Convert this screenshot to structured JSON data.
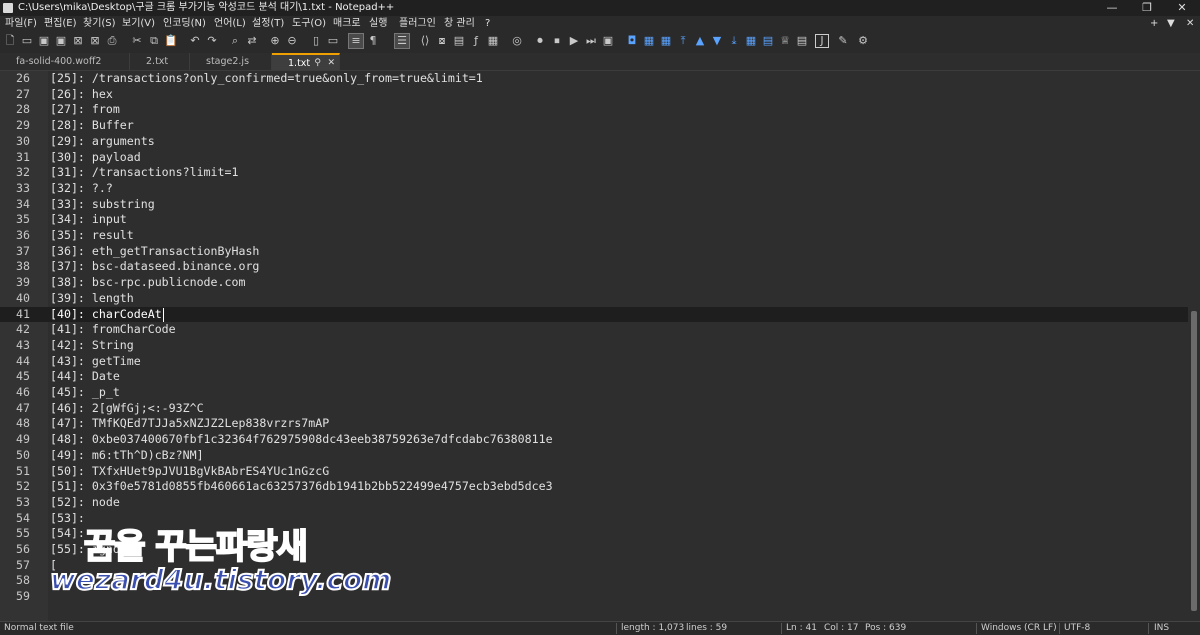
{
  "window": {
    "title": "C:\\Users\\mika\\Desktop\\구글 크롬 부가기능 악성코드 분석 대기\\1.txt - Notepad++",
    "minimize": "—",
    "maximize": "❐",
    "close": "✕"
  },
  "menu": {
    "items": [
      "파일(F)",
      "편집(E)",
      "찾기(S)",
      "보기(V)",
      "인코딩(N)",
      "언어(L)",
      "설정(T)",
      "도구(O)",
      "매크로",
      "실행",
      "플러그인",
      "창 관리",
      "?"
    ],
    "right": [
      "+",
      "▼",
      "✕"
    ]
  },
  "toolbar": {
    "icons": [
      "new-file-icon",
      "open-file-icon",
      "save-icon",
      "save-all-icon",
      "close-icon",
      "close-all-icon",
      "print-icon",
      "cut-icon",
      "copy-icon",
      "paste-icon",
      "undo-icon",
      "redo-icon",
      "find-icon",
      "replace-icon",
      "zoom-in-icon",
      "zoom-out-icon",
      "sync-vertical-icon",
      "sync-horizontal-icon",
      "word-wrap-icon",
      "show-all-chars-icon",
      "indent-guide-icon",
      "udl-icon",
      "xml-icon",
      "doc-map-icon",
      "function-list-icon",
      "folder-workspace-icon",
      "monitor-icon",
      "record-macro-icon",
      "stop-macro-icon",
      "play-macro-icon",
      "run-macro-multiple-icon",
      "save-macro-icon",
      "plugin-1-icon",
      "plugin-2-icon",
      "plugin-3-icon",
      "plugin-4-icon",
      "plugin-5-icon",
      "plugin-6-icon",
      "plugin-7-icon",
      "plugin-8-icon",
      "plugin-9-icon",
      "plugin-10-icon",
      "plugin-11-icon",
      "plugin-12-icon",
      "plugin-13-icon",
      "plugin-14-icon"
    ]
  },
  "tabs": [
    {
      "label": "fa-solid-400.woff2",
      "active": false
    },
    {
      "label": "2.txt",
      "active": false
    },
    {
      "label": "stage2.js",
      "active": false
    },
    {
      "label": "1.txt",
      "active": true
    }
  ],
  "editor": {
    "current_line": 41,
    "lines": [
      {
        "n": "26",
        "text": "[25]: /transactions?only_confirmed=true&only_from=true&limit=1"
      },
      {
        "n": "27",
        "text": "[26]: hex"
      },
      {
        "n": "28",
        "text": "[27]: from"
      },
      {
        "n": "29",
        "text": "[28]: Buffer"
      },
      {
        "n": "30",
        "text": "[29]: arguments"
      },
      {
        "n": "31",
        "text": "[30]: payload"
      },
      {
        "n": "32",
        "text": "[31]: /transactions?limit=1"
      },
      {
        "n": "33",
        "text": "[32]: ?.?"
      },
      {
        "n": "34",
        "text": "[33]: substring"
      },
      {
        "n": "35",
        "text": "[34]: input"
      },
      {
        "n": "36",
        "text": "[35]: result"
      },
      {
        "n": "37",
        "text": "[36]: eth_getTransactionByHash"
      },
      {
        "n": "38",
        "text": "[37]: bsc-dataseed.binance.org"
      },
      {
        "n": "39",
        "text": "[38]: bsc-rpc.publicnode.com"
      },
      {
        "n": "40",
        "text": "[39]: length"
      },
      {
        "n": "41",
        "text": "[40]: charCodeAt"
      },
      {
        "n": "42",
        "text": "[41]: fromCharCode"
      },
      {
        "n": "43",
        "text": "[42]: String"
      },
      {
        "n": "44",
        "text": "[43]: getTime"
      },
      {
        "n": "45",
        "text": "[44]: Date"
      },
      {
        "n": "46",
        "text": "[45]: _p_t"
      },
      {
        "n": "47",
        "text": "[46]: 2[gWfGj;<:-93Z^C"
      },
      {
        "n": "48",
        "text": "[47]: TMfKQEd7TJJa5xNZJZ2Lep838vrzrs7mAP"
      },
      {
        "n": "49",
        "text": "[48]: 0xbe037400670fbf1c32364f762975908dc43eeb38759263e7dfcdabc76380811e"
      },
      {
        "n": "50",
        "text": "[49]: m6:tTh^D)cBz?NM]"
      },
      {
        "n": "51",
        "text": "[50]: TXfxHUet9pJVU1BgVkBAbrES4YUc1nGzcG"
      },
      {
        "n": "52",
        "text": "[51]: 0x3f0e5781d0855fb460661ac63257376db1941b2bb522499e4757ecb3ebd5dce3"
      },
      {
        "n": "53",
        "text": "[52]: node"
      },
      {
        "n": "54",
        "text": "[53]:"
      },
      {
        "n": "55",
        "text": "[54]:"
      },
      {
        "n": "56",
        "text": "[55]: ignore"
      },
      {
        "n": "57",
        "text": "["
      },
      {
        "n": "58",
        "text": ""
      },
      {
        "n": "59",
        "text": ""
      }
    ]
  },
  "watermark": {
    "line1": "꿈을 꾸는파랑새",
    "line2": "wezard4u.tistory.com"
  },
  "status": {
    "file_type": "Normal text file",
    "length": "length : 1,073",
    "lines": "lines : 59",
    "ln": "Ln : 41",
    "col": "Col : 17",
    "pos": "Pos : 639",
    "eol": "Windows (CR LF)",
    "encoding": "UTF-8",
    "mode": "INS"
  }
}
